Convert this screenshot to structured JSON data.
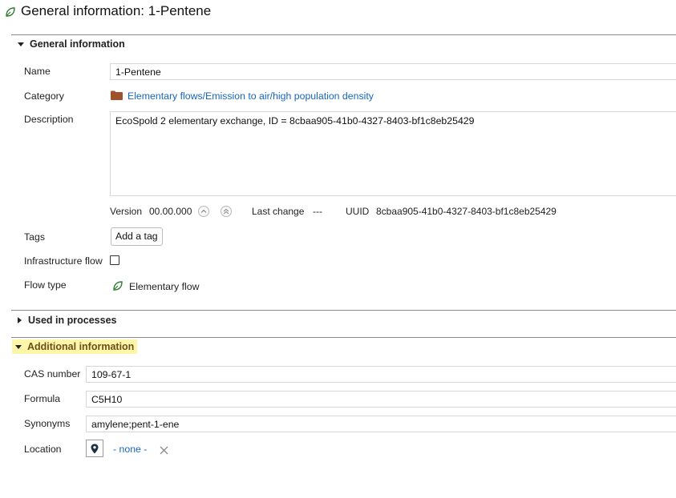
{
  "page_title": "General information: 1-Pentene",
  "sections": {
    "general": {
      "title": "General information",
      "name_label": "Name",
      "name_value": "1-Pentene",
      "category_label": "Category",
      "category_value": "Elementary flows/Emission to air/high population density",
      "description_label": "Description",
      "description_value": "EcoSpold 2 elementary exchange, ID = 8cbaa905-41b0-4327-8403-bf1c8eb25429",
      "version_label": "Version",
      "version_value": "00.00.000",
      "last_change_label": "Last change",
      "last_change_value": "---",
      "uuid_label": "UUID",
      "uuid_value": "8cbaa905-41b0-4327-8403-bf1c8eb25429",
      "tags_label": "Tags",
      "add_tag_button": "Add a tag",
      "infrastructure_label": "Infrastructure flow",
      "infrastructure_checked": false,
      "flow_type_label": "Flow type",
      "flow_type_value": "Elementary flow"
    },
    "used_in_processes": {
      "title": "Used in processes"
    },
    "additional": {
      "title": "Additional information",
      "cas_label": "CAS number",
      "cas_value": "109-67-1",
      "formula_label": "Formula",
      "formula_value": "C5H10",
      "synonyms_label": "Synonyms",
      "synonyms_value": "amylene;pent-1-ene",
      "location_label": "Location",
      "location_value": "- none -"
    }
  },
  "colors": {
    "link": "#1565c0",
    "highlight": "#fff6a8",
    "folder": "#a0522d",
    "leaf": "#2e7d32"
  }
}
